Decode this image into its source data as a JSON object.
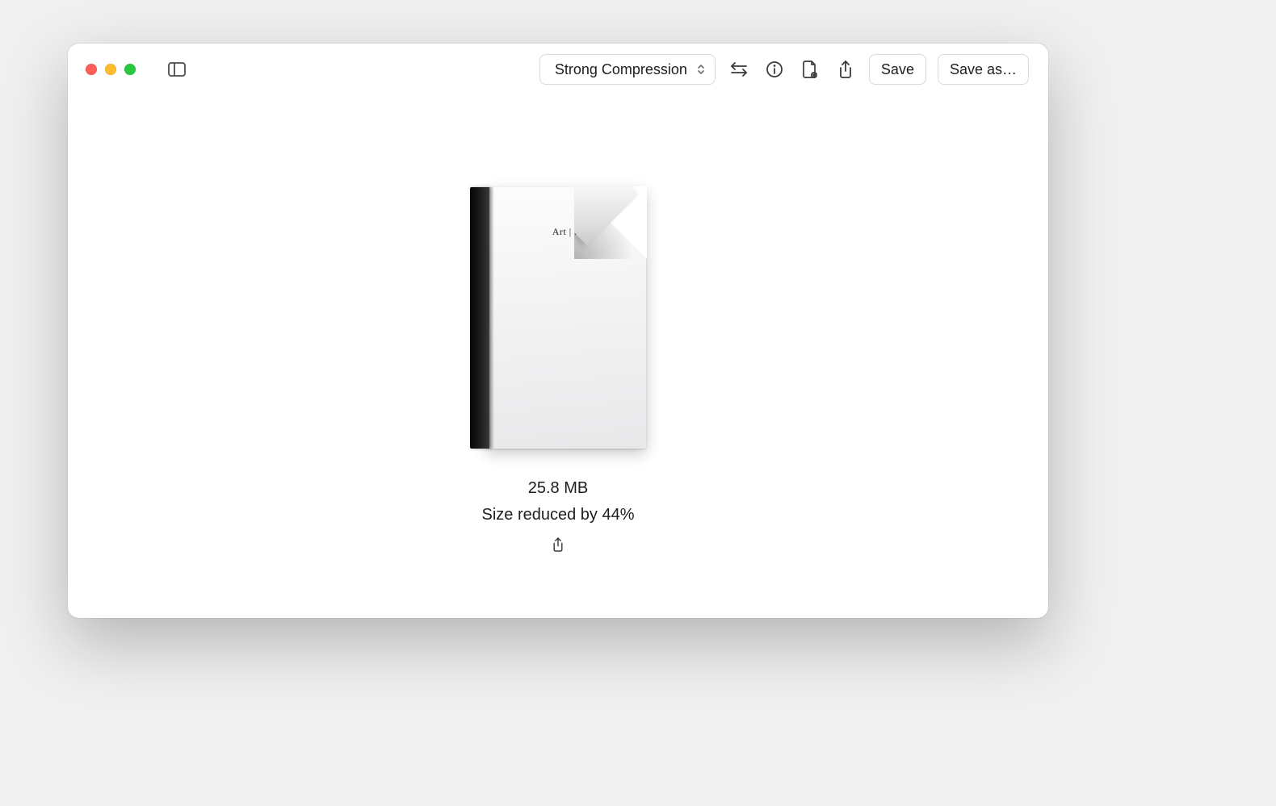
{
  "toolbar": {
    "compression_label": "Strong Compression",
    "save_label": "Save",
    "save_as_label": "Save as…"
  },
  "document": {
    "cover_text": "Art | S",
    "size_text": "25.8 MB",
    "reduced_text": "Size reduced by 44%"
  }
}
